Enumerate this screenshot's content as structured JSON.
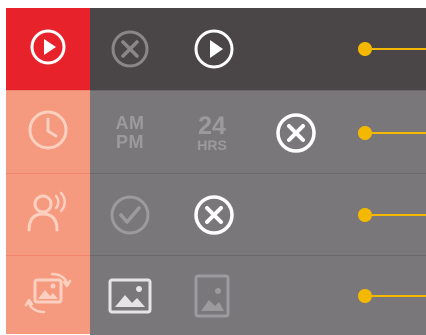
{
  "colors": {
    "accent_red": "#e8222b",
    "sidebar_inactive": "#f59a7e",
    "row_active_bg": "#4a4647",
    "row_bg": "#79777a",
    "connector": "#f5b800"
  },
  "rows": [
    {
      "sidebar_icon": "play-icon",
      "options": [
        {
          "icon": "close-circle-icon",
          "state": "dimmed"
        },
        {
          "icon": "play-circle-icon",
          "state": "selected"
        }
      ]
    },
    {
      "sidebar_icon": "clock-icon",
      "options": [
        {
          "icon": "am-pm-format",
          "state": "dimmed",
          "lines": [
            "AM",
            "PM"
          ]
        },
        {
          "icon": "24-hour-format",
          "state": "dimmed",
          "number": "24",
          "unit": "HRS"
        },
        {
          "icon": "close-circle-icon",
          "state": "selected"
        }
      ]
    },
    {
      "sidebar_icon": "person-voice-icon",
      "options": [
        {
          "icon": "check-circle-icon",
          "state": "dimmed"
        },
        {
          "icon": "close-circle-icon",
          "state": "selected"
        }
      ]
    },
    {
      "sidebar_icon": "rotate-image-icon",
      "options": [
        {
          "icon": "landscape-image-icon",
          "state": "selected"
        },
        {
          "icon": "portrait-image-icon",
          "state": "dimmed"
        }
      ]
    }
  ]
}
